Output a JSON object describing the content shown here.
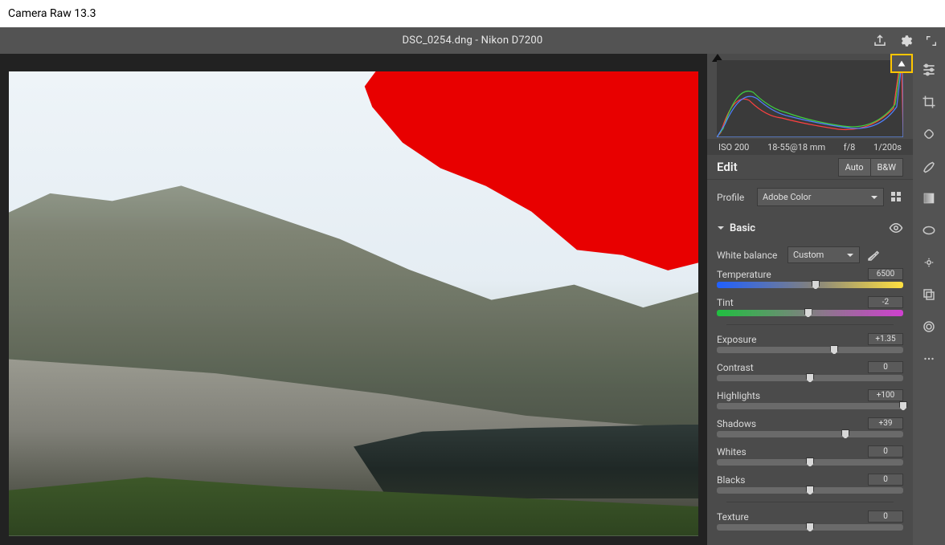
{
  "app_title": "Camera Raw 13.3",
  "file_title": "DSC_0254.dng  -  Nikon D7200",
  "exif": {
    "iso": "ISO 200",
    "lens": "18-55@18 mm",
    "aperture": "f/8",
    "shutter": "1/200s"
  },
  "edit": {
    "heading": "Edit",
    "auto": "Auto",
    "bw": "B&W"
  },
  "profile": {
    "label": "Profile",
    "value": "Adobe Color"
  },
  "basic": {
    "heading": "Basic",
    "wb_label": "White balance",
    "wb_value": "Custom",
    "sliders": {
      "temperature": {
        "label": "Temperature",
        "value": "6500",
        "pos": 53
      },
      "tint": {
        "label": "Tint",
        "value": "-2",
        "pos": 49
      },
      "exposure": {
        "label": "Exposure",
        "value": "+1.35",
        "pos": 63
      },
      "contrast": {
        "label": "Contrast",
        "value": "0",
        "pos": 50
      },
      "highlights": {
        "label": "Highlights",
        "value": "+100",
        "pos": 100
      },
      "shadows": {
        "label": "Shadows",
        "value": "+39",
        "pos": 69
      },
      "whites": {
        "label": "Whites",
        "value": "0",
        "pos": 50
      },
      "blacks": {
        "label": "Blacks",
        "value": "0",
        "pos": 50
      },
      "texture": {
        "label": "Texture",
        "value": "0",
        "pos": 50
      }
    }
  }
}
